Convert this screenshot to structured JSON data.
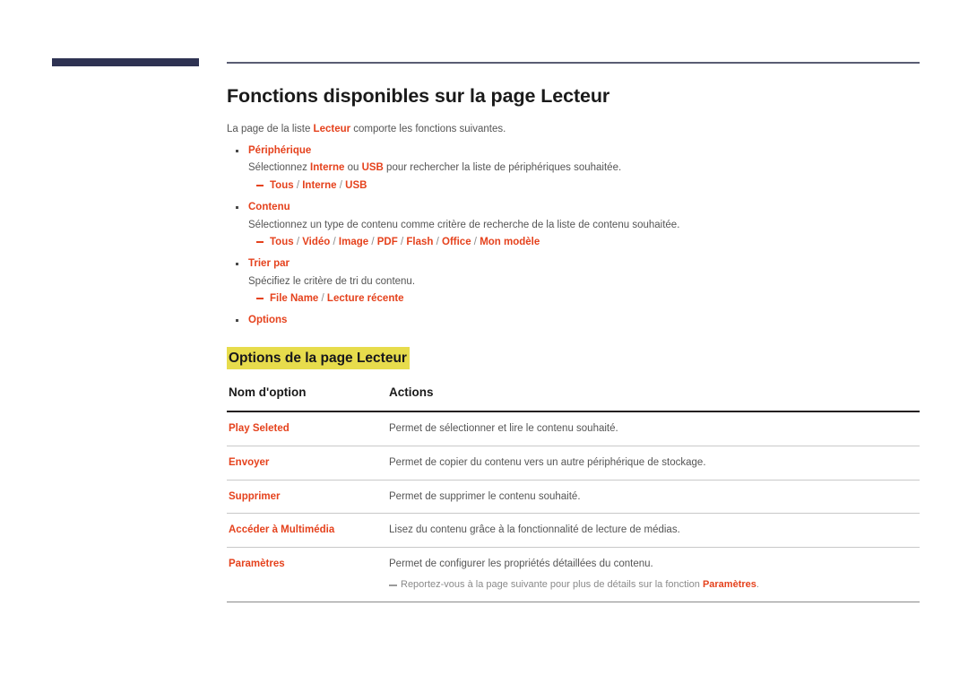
{
  "header": {
    "bar_color": "#2e3252",
    "rule_color": "#5a5d73"
  },
  "page": {
    "title": "Fonctions disponibles sur la page Lecteur",
    "intro_before": "La page de la liste ",
    "intro_highlight": "Lecteur",
    "intro_after": " comporte les fonctions suivantes."
  },
  "bullets": [
    {
      "label": "Périphérique",
      "desc_before": "Sélectionnez ",
      "desc_hl1": "Interne",
      "desc_mid": " ou ",
      "desc_hl2": "USB",
      "desc_after": " pour rechercher la liste de périphériques souhaitée.",
      "sub": "Tous / Interne / USB",
      "sub_parts": [
        "Tous",
        "Interne",
        "USB"
      ]
    },
    {
      "label": "Contenu",
      "desc": "Sélectionnez un type de contenu comme critère de recherche de la liste de contenu souhaitée.",
      "sub": "Tous / Vidéo / Image / PDF / Flash / Office / Mon modèle",
      "sub_parts": [
        "Tous",
        "Vidéo",
        "Image",
        "PDF",
        "Flash",
        "Office",
        "Mon modèle"
      ]
    },
    {
      "label": "Trier par",
      "desc": "Spécifiez le critère de tri du contenu.",
      "sub": "File Name / Lecture récente",
      "sub_parts": [
        "File Name",
        "Lecture récente"
      ]
    },
    {
      "label": "Options"
    }
  ],
  "section": {
    "heading": "Options de la page Lecteur",
    "highlight_color": "#e7dc4c"
  },
  "table": {
    "columns": [
      "Nom d'option",
      "Actions"
    ],
    "rows": [
      {
        "name": "Play Seleted",
        "action": "Permet de sélectionner et lire le contenu souhaité."
      },
      {
        "name": "Envoyer",
        "action": "Permet de copier du contenu vers un autre périphérique de stockage."
      },
      {
        "name": "Supprimer",
        "action": "Permet de supprimer le contenu souhaité."
      },
      {
        "name": "Accéder à Multimédia",
        "action": "Lisez du contenu grâce à la fonctionnalité de lecture de médias."
      },
      {
        "name": "Paramètres",
        "action": "Permet de configurer les propriétés détaillées du contenu.",
        "note_before": "Reportez-vous à la page suivante pour plus de détails sur la fonction ",
        "note_highlight": "Paramètres",
        "note_after": "."
      }
    ]
  },
  "colors": {
    "accent": "#e5421d",
    "body_text": "#555555",
    "heading_text": "#1a1a1a",
    "navy": "#2e3252",
    "highlight_yellow": "#e7dc4c"
  }
}
